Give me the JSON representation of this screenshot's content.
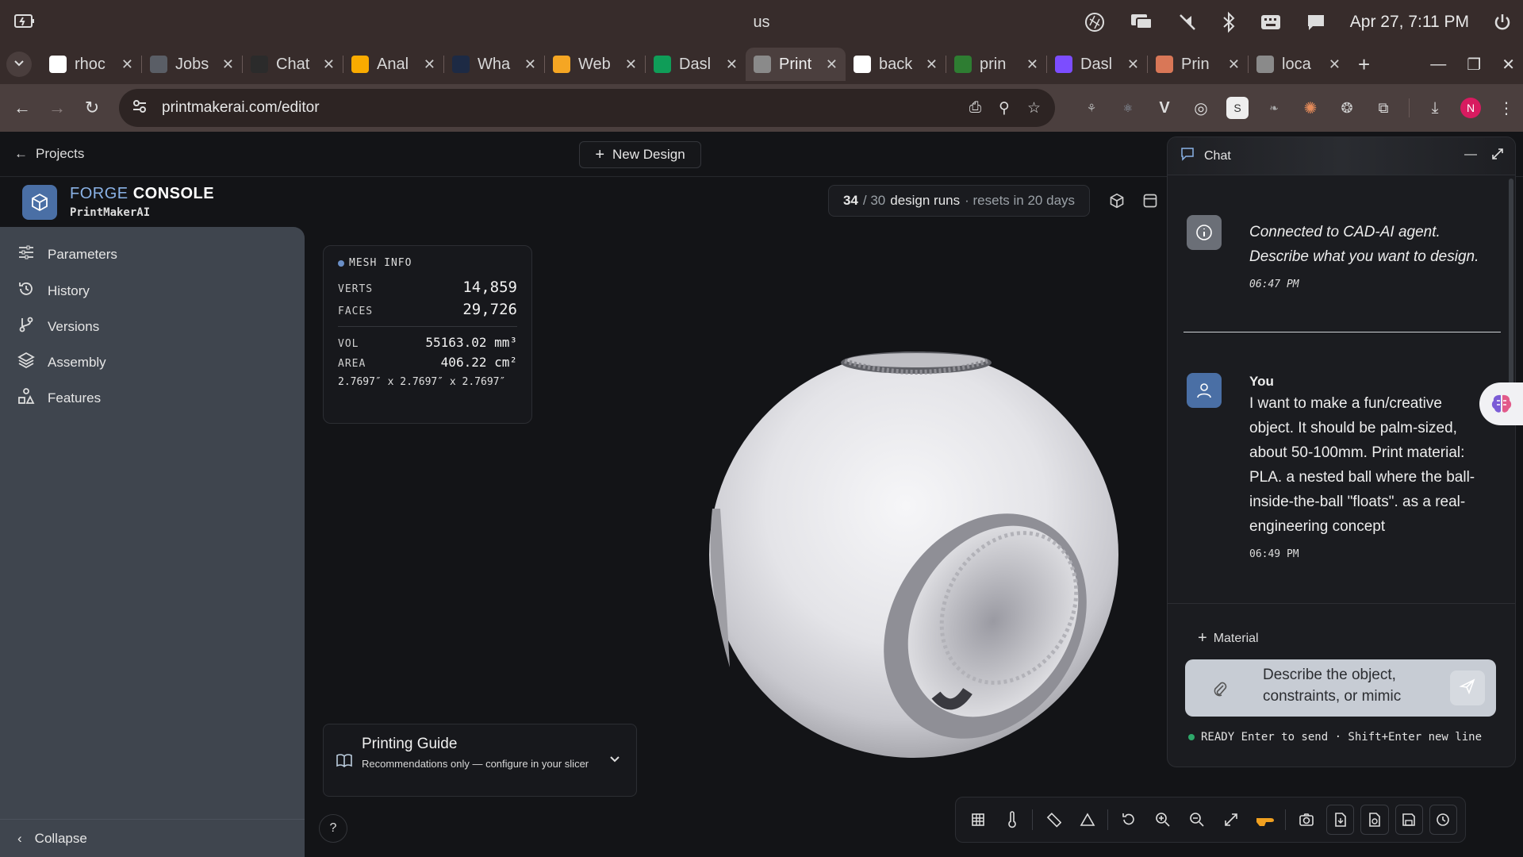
{
  "os": {
    "keyboard_layout": "us",
    "datetime": "Apr 27, 7:11 PM"
  },
  "browser": {
    "tabs": [
      {
        "title": "rhoc",
        "favicon": "google-icon",
        "color": "#ffffff"
      },
      {
        "title": "Jobs",
        "favicon": "blt-icon",
        "color": "#5a5e66"
      },
      {
        "title": "Chat",
        "favicon": "openai-icon",
        "color": "#2b2b2b"
      },
      {
        "title": "Anal",
        "favicon": "analytics-icon",
        "color": "#f9ab00"
      },
      {
        "title": "Wha",
        "favicon": "v-icon",
        "color": "#1d2a44"
      },
      {
        "title": "Web",
        "favicon": "cloud-icon",
        "color": "#f5a623"
      },
      {
        "title": "Dasl",
        "favicon": "sheet-icon",
        "color": "#0f9d58"
      },
      {
        "title": "Print",
        "favicon": "globe-icon",
        "color": "#8a8a8a"
      },
      {
        "title": "back",
        "favicon": "badge-icon",
        "color": "#ffffff"
      },
      {
        "title": "prin",
        "favicon": "frog-icon",
        "color": "#2e7d32"
      },
      {
        "title": "Dasl",
        "favicon": "square-icon",
        "color": "#7c4dff"
      },
      {
        "title": "Prin",
        "favicon": "claude-icon",
        "color": "#d97757"
      },
      {
        "title": "loca",
        "favicon": "globe-icon",
        "color": "#8a8a8a"
      }
    ],
    "url": "printmakerai.com/editor"
  },
  "app": {
    "back_label": "Projects",
    "new_design_label": "New Design",
    "brand_accent": "FORGE",
    "brand_rest": "CONSOLE",
    "brand_sub": "PrintMakerAI",
    "runs_used": "34",
    "runs_total": "/ 30",
    "runs_label": "design runs",
    "runs_reset": "· resets in 20 days"
  },
  "sidebar": {
    "items": [
      {
        "label": "Parameters",
        "icon": "sliders-icon"
      },
      {
        "label": "History",
        "icon": "history-icon"
      },
      {
        "label": "Versions",
        "icon": "git-branch-icon"
      },
      {
        "label": "Assembly",
        "icon": "layers-icon"
      },
      {
        "label": "Features",
        "icon": "shapes-icon"
      }
    ],
    "collapse_label": "Collapse"
  },
  "mesh": {
    "title": "MESH INFO",
    "verts_label": "VERTS",
    "verts": "14,859",
    "faces_label": "FACES",
    "faces": "29,726",
    "vol_label": "VOL",
    "vol": "55163.02 mm³",
    "area_label": "AREA",
    "area": "406.22 cm²",
    "dims": "2.7697″ x 2.7697″ x 2.7697″"
  },
  "guide": {
    "title": "Printing Guide",
    "subtitle": "Recommendations only — configure in your slicer"
  },
  "help_label": "?",
  "chat": {
    "title": "Chat",
    "messages": [
      {
        "role": "system",
        "text": "Connected to CAD-AI agent. Describe what you want to design.",
        "time": "06:47 PM"
      },
      {
        "role": "user",
        "author": "You",
        "text": "I want to make a fun/creative object. It should be palm-sized, about 50-100mm. Print material: PLA. a nested ball where the ball-inside-the-ball \"floats\". as a real-engineering concept",
        "time": "06:49 PM"
      }
    ],
    "material_label": "Material",
    "placeholder": "Describe the object, constraints, or mimic target",
    "status": "READY Enter to send · Shift+Enter new line"
  },
  "colors": {
    "accent": "#8ab2e6",
    "sidebar": "#3f454e",
    "status_ready": "#2ea86a"
  }
}
